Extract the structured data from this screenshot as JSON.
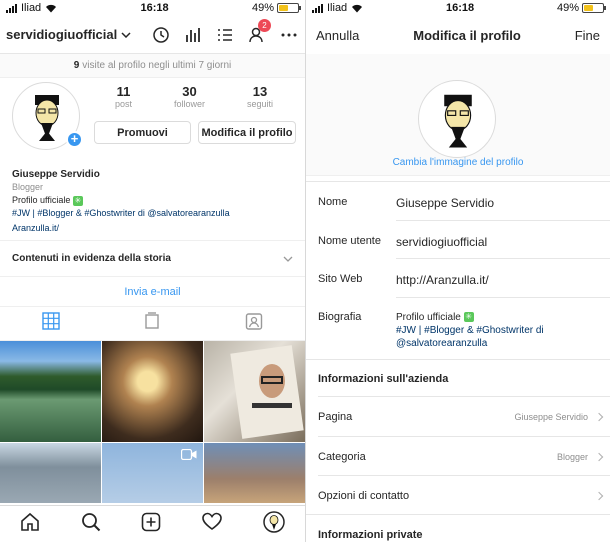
{
  "status_left": {
    "carrier": "Iliad",
    "time": "16:18",
    "battery": "49%"
  },
  "status_right": {
    "carrier": "Iliad",
    "time": "16:18",
    "battery": "49%"
  },
  "battery_level": 0.49,
  "profile": {
    "username": "servidiogiuofficial",
    "activity_badge": "2",
    "visits_count": "9",
    "visits_text": "visite al profilo negli ultimi 7 giorni",
    "posts_n": "11",
    "posts_label": "post",
    "followers_n": "30",
    "followers_label": "follower",
    "following_n": "13",
    "following_label": "seguiti",
    "promote_label": "Promuovi",
    "edit_label": "Modifica il profilo",
    "full_name": "Giuseppe Servidio",
    "category": "Blogger",
    "bio_line1": "Profilo ufficiale",
    "bio_tags": "#JW | #Blogger & #Ghostwriter di @salvatorearanzulla",
    "website": "Aranzulla.it/",
    "highlights_label": "Contenuti in evidenza della storia",
    "email_label": "Invia e-mail"
  },
  "edit": {
    "cancel": "Annulla",
    "title": "Modifica il profilo",
    "done": "Fine",
    "change_photo": "Cambia l'immagine del profilo",
    "name_label": "Nome",
    "name_value": "Giuseppe Servidio",
    "username_label": "Nome utente",
    "username_value": "servidiogiuofficial",
    "website_label": "Sito Web",
    "website_value": "http://Aranzulla.it/",
    "bio_label": "Biografia",
    "bio_line1": "Profilo ufficiale",
    "bio_line2": "#JW | #Blogger & #Ghostwriter di",
    "bio_line3": "@salvatorearanzulla",
    "business_section": "Informazioni sull'azienda",
    "page_label": "Pagina",
    "page_value": "Giuseppe Servidio",
    "category_label": "Categoria",
    "category_value": "Blogger",
    "contact_label": "Opzioni di contatto",
    "private_section": "Informazioni private"
  },
  "colors": {
    "accent": "#3897f0",
    "badge": "#ed4956",
    "battery": "#f2c21b",
    "bio_icon": "#5ac85a"
  }
}
